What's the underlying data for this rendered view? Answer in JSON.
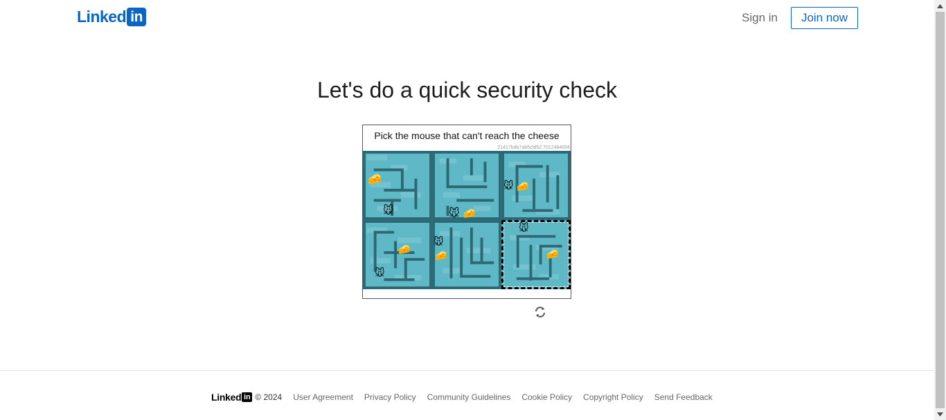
{
  "header": {
    "logo_word": "Linked",
    "logo_box": "in",
    "signin_label": "Sign in",
    "join_label": "Join now"
  },
  "main": {
    "title": "Let's do a quick security check"
  },
  "captcha": {
    "prompt": "Pick the mouse that can't reach the cheese",
    "hash": "21417bdb7ab5cfd52.7012484004",
    "tiles": [
      {
        "label": "maze-1",
        "selected": false
      },
      {
        "label": "maze-2",
        "selected": false
      },
      {
        "label": "maze-3",
        "selected": false
      },
      {
        "label": "maze-4",
        "selected": false
      },
      {
        "label": "maze-5",
        "selected": false
      },
      {
        "label": "maze-6",
        "selected": true
      }
    ],
    "refresh_icon": "refresh-icon"
  },
  "footer": {
    "logo_word": "Linked",
    "logo_box": "in",
    "copyright": "© 2024",
    "links": [
      "User Agreement",
      "Privacy Policy",
      "Community Guidelines",
      "Cookie Policy",
      "Copyright Policy",
      "Send Feedback"
    ]
  },
  "colors": {
    "brand": "#0a66c2",
    "maze_bg": "#5fb8c6",
    "maze_wall": "#2d6774"
  }
}
